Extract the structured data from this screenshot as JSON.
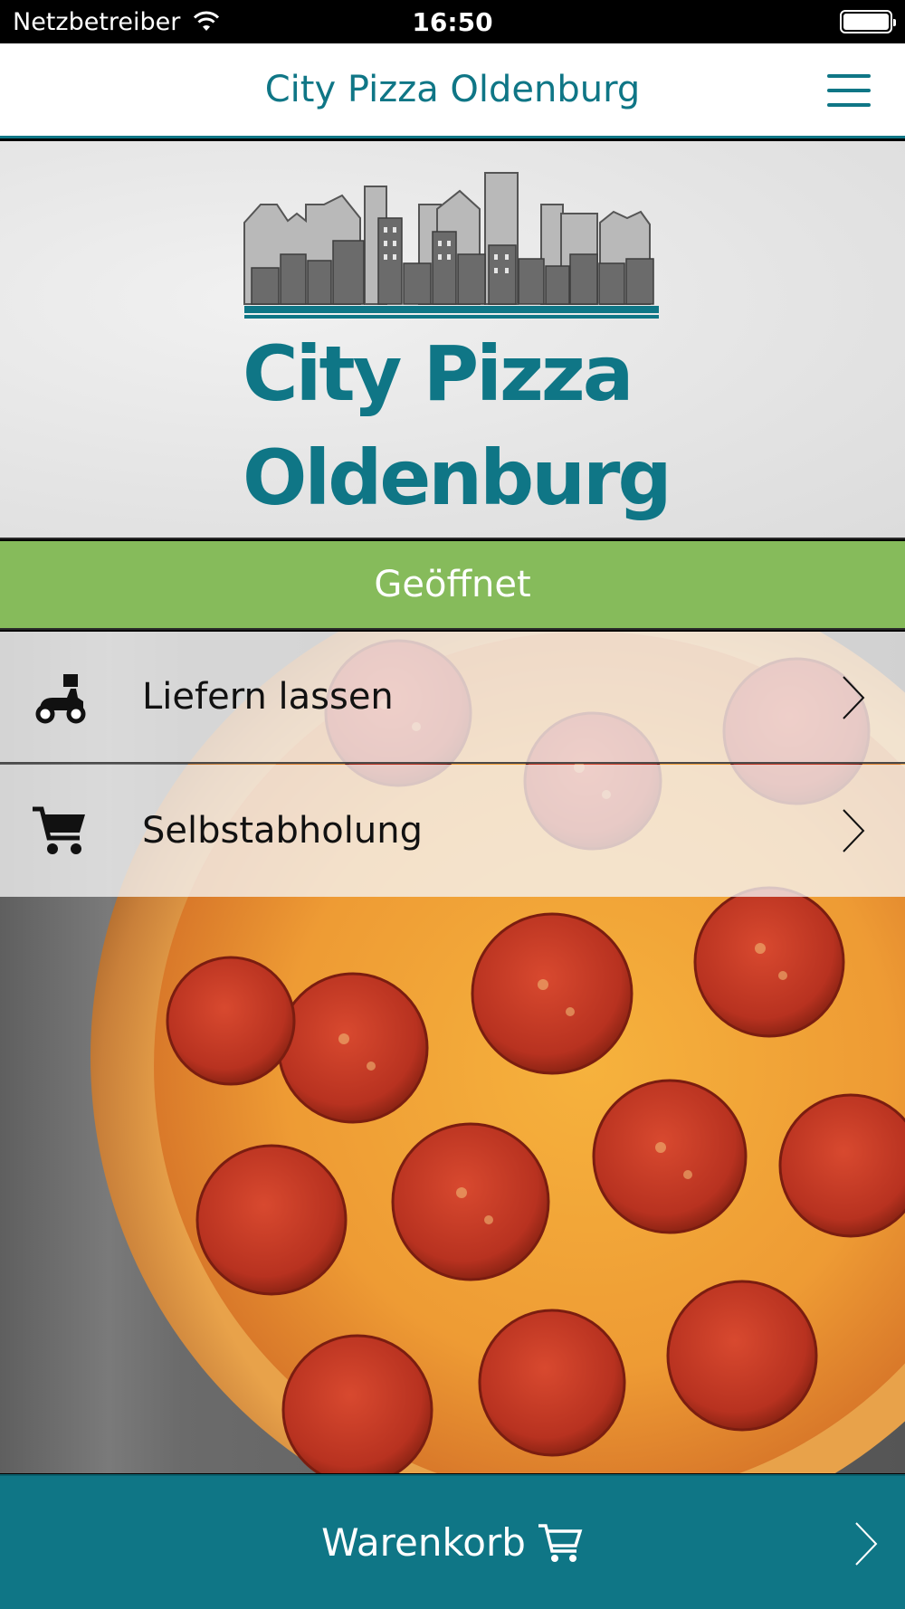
{
  "status_bar": {
    "carrier": "Netzbetreiber",
    "time": "16:50"
  },
  "header": {
    "title": "City Pizza Oldenburg"
  },
  "logo": {
    "line1": "City Pizza",
    "line2": "Oldenburg"
  },
  "status_banner": {
    "label": "Geöffnet",
    "color": "#86bb5b"
  },
  "options": [
    {
      "label": "Liefern lassen",
      "icon": "delivery-scooter-icon"
    },
    {
      "label": "Selbstabholung",
      "icon": "shopping-cart-icon"
    }
  ],
  "cart": {
    "label": "Warenkorb",
    "icon": "cart-outline-icon"
  },
  "colors": {
    "brand": "#0f7686",
    "open": "#86bb5b"
  }
}
